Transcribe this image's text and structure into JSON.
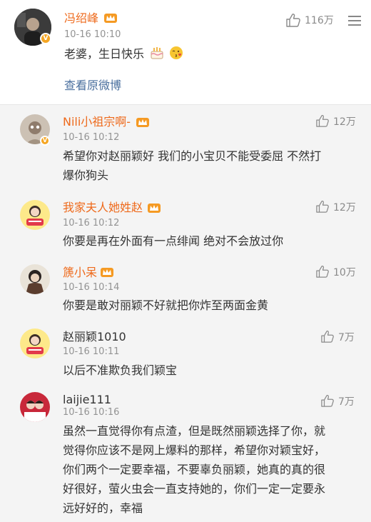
{
  "post": {
    "author": "冯绍峰",
    "time": "10-16 10:10",
    "text": "老婆，生日快乐",
    "likes": "116万",
    "view_original": "查看原微博",
    "emoji": [
      "cake-emoji",
      "kiss-emoji"
    ]
  },
  "comments": [
    {
      "name": "Nili小祖宗啊-",
      "time": "10-16 10:12",
      "likes": "12万",
      "lines": [
        "希望你对赵丽颖好 我们的小宝贝不能受委屈 不然打",
        "爆你狗头"
      ]
    },
    {
      "name": "我家夫人她姓赵",
      "time": "10-16 10:12",
      "likes": "12万",
      "lines": [
        "你要是再在外面有一点绯闻  绝对不会放过你"
      ]
    },
    {
      "name": "篪小呆",
      "time": "10-16 10:14",
      "likes": "10万",
      "lines": [
        "你要是敢对丽颖不好就把你炸至两面金黄"
      ]
    },
    {
      "name": "赵丽颖1010",
      "time": "10-16 10:11",
      "likes": "7万",
      "lines": [
        "以后不准欺负我们颖宝"
      ]
    },
    {
      "name": "laijie111",
      "time": "10-16 10:16",
      "likes": "7万",
      "lines": [
        "虽然一直觉得你有点渣，但是既然丽颖选择了你，就",
        "觉得你应该不是网上爆料的那样，希望你对颖宝好，",
        "你们两个一定要幸福，不要辜负丽颖，她真的真的很",
        "好很好，萤火虫会一直支持她的，你们一定一定要永",
        "远好好的，幸福"
      ]
    }
  ],
  "colors": {
    "vip_name": "#ee6a1c",
    "link": "#4a6f9e",
    "comment_bg": "#f4f4f4",
    "meta": "#939393"
  }
}
